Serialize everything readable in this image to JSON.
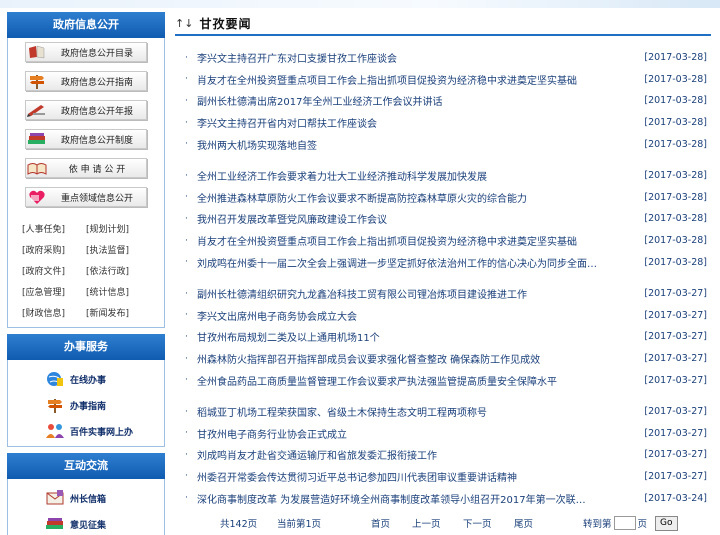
{
  "sidebar": {
    "gov_info": {
      "title": "政府信息公开",
      "buttons": [
        {
          "label": "政府信息公开目录",
          "icon": "book-icon"
        },
        {
          "label": "政府信息公开指南",
          "icon": "signpost-icon"
        },
        {
          "label": "政府信息公开年报",
          "icon": "pen-icon"
        },
        {
          "label": "政府信息公开制度",
          "icon": "books-icon"
        },
        {
          "label": "依 申 请 公 开",
          "icon": "open-book-icon"
        },
        {
          "label": "重点领域信息公开",
          "icon": "heart-icon"
        }
      ],
      "tags": [
        "[人事任免]",
        "[规划计划]",
        "[政府采购]",
        "[执法监督]",
        "[政府文件]",
        "[依法行政]",
        "[应急管理]",
        "[统计信息]",
        "[财政信息]",
        "[新闻发布]"
      ]
    },
    "services": {
      "title": "办事服务",
      "items": [
        {
          "label": "在线办事",
          "icon": "globe-icon"
        },
        {
          "label": "办事指南",
          "icon": "signpost-icon"
        },
        {
          "label": "百件实事网上办",
          "icon": "people-icon"
        }
      ]
    },
    "interact": {
      "title": "互动交流",
      "items": [
        {
          "label": "州长信箱",
          "icon": "envelope-icon"
        },
        {
          "label": "意见征集",
          "icon": "books-icon"
        }
      ]
    }
  },
  "main": {
    "title": "甘孜要闻",
    "groups": [
      [
        {
          "title": "李兴文主持召开广东对口支援甘孜工作座谈会",
          "date": "[2017-03-28]"
        },
        {
          "title": "肖友才在全州投资暨重点项目工作会上指出抓项目促投资为经济稳中求进奠定坚实基础",
          "date": "[2017-03-28]"
        },
        {
          "title": "副州长杜德清出席2017年全州工业经济工作会议并讲话",
          "date": "[2017-03-28]"
        },
        {
          "title": "李兴文主持召开省内对口帮扶工作座谈会",
          "date": "[2017-03-28]"
        },
        {
          "title": "我州两大机场实现落地自签",
          "date": "[2017-03-28]"
        }
      ],
      [
        {
          "title": "全州工业经济工作会要求着力壮大工业经济推动科学发展加快发展",
          "date": "[2017-03-28]"
        },
        {
          "title": "全州推进森林草原防火工作会议要求不断提高防控森林草原火灾的综合能力",
          "date": "[2017-03-28]"
        },
        {
          "title": "我州召开发展改革暨党风廉政建设工作会议",
          "date": "[2017-03-28]"
        },
        {
          "title": "肖友才在全州投资暨重点项目工作会上指出抓项目促投资为经济稳中求进奠定坚实基础",
          "date": "[2017-03-28]"
        },
        {
          "title": "刘成鸣在州委十一届二次全会上强调进一步坚定抓好依法治州工作的信心决心为同步全面…",
          "date": "[2017-03-28]"
        }
      ],
      [
        {
          "title": "副州长杜德清组织研究九龙鑫冶科技工贸有限公司锂冶炼项目建设推进工作",
          "date": "[2017-03-27]"
        },
        {
          "title": "李兴文出席州电子商务协会成立大会",
          "date": "[2017-03-27]"
        },
        {
          "title": "甘孜州布局规划二类及以上通用机场11个",
          "date": "[2017-03-27]"
        },
        {
          "title": "州森林防火指挥部召开指挥部成员会议要求强化督查整改 确保森防工作见成效",
          "date": "[2017-03-27]"
        },
        {
          "title": "全州食品药品工商质量监督管理工作会议要求严执法强监管提高质量安全保障水平",
          "date": "[2017-03-27]"
        }
      ],
      [
        {
          "title": "稻城亚丁机场工程荣获国家、省级土木保持生态文明工程两项称号",
          "date": "[2017-03-27]"
        },
        {
          "title": "甘孜州电子商务行业协会正式成立",
          "date": "[2017-03-27]"
        },
        {
          "title": "刘成鸣肖友才赴省交通运输厅和省旅发委汇报衔接工作",
          "date": "[2017-03-27]"
        },
        {
          "title": "州委召开常委会传达贯彻习近平总书记参加四川代表团审议重要讲话精神",
          "date": "[2017-03-27]"
        },
        {
          "title": "深化商事制度改革 为发展营造好环境全州商事制度改革领导小组召开2017年第一次联…",
          "date": "[2017-03-24]"
        }
      ]
    ],
    "pager": {
      "total": "共142页",
      "current": "当前第1页",
      "first": "首页",
      "prev": "上一页",
      "next": "下一页",
      "last": "尾页",
      "jump_prefix": "转到第",
      "jump_suffix": "页",
      "go": "Go"
    }
  }
}
